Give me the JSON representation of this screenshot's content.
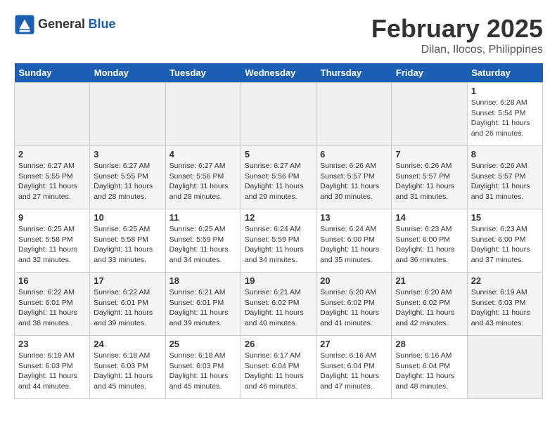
{
  "header": {
    "logo_general": "General",
    "logo_blue": "Blue",
    "title": "February 2025",
    "subtitle": "Dilan, Ilocos, Philippines"
  },
  "weekdays": [
    "Sunday",
    "Monday",
    "Tuesday",
    "Wednesday",
    "Thursday",
    "Friday",
    "Saturday"
  ],
  "weeks": [
    [
      {
        "day": "",
        "info": ""
      },
      {
        "day": "",
        "info": ""
      },
      {
        "day": "",
        "info": ""
      },
      {
        "day": "",
        "info": ""
      },
      {
        "day": "",
        "info": ""
      },
      {
        "day": "",
        "info": ""
      },
      {
        "day": "1",
        "info": "Sunrise: 6:28 AM\nSunset: 5:54 PM\nDaylight: 11 hours and 26 minutes."
      }
    ],
    [
      {
        "day": "2",
        "info": "Sunrise: 6:27 AM\nSunset: 5:55 PM\nDaylight: 11 hours and 27 minutes."
      },
      {
        "day": "3",
        "info": "Sunrise: 6:27 AM\nSunset: 5:55 PM\nDaylight: 11 hours and 28 minutes."
      },
      {
        "day": "4",
        "info": "Sunrise: 6:27 AM\nSunset: 5:56 PM\nDaylight: 11 hours and 28 minutes."
      },
      {
        "day": "5",
        "info": "Sunrise: 6:27 AM\nSunset: 5:56 PM\nDaylight: 11 hours and 29 minutes."
      },
      {
        "day": "6",
        "info": "Sunrise: 6:26 AM\nSunset: 5:57 PM\nDaylight: 11 hours and 30 minutes."
      },
      {
        "day": "7",
        "info": "Sunrise: 6:26 AM\nSunset: 5:57 PM\nDaylight: 11 hours and 31 minutes."
      },
      {
        "day": "8",
        "info": "Sunrise: 6:26 AM\nSunset: 5:57 PM\nDaylight: 11 hours and 31 minutes."
      }
    ],
    [
      {
        "day": "9",
        "info": "Sunrise: 6:25 AM\nSunset: 5:58 PM\nDaylight: 11 hours and 32 minutes."
      },
      {
        "day": "10",
        "info": "Sunrise: 6:25 AM\nSunset: 5:58 PM\nDaylight: 11 hours and 33 minutes."
      },
      {
        "day": "11",
        "info": "Sunrise: 6:25 AM\nSunset: 5:59 PM\nDaylight: 11 hours and 34 minutes."
      },
      {
        "day": "12",
        "info": "Sunrise: 6:24 AM\nSunset: 5:59 PM\nDaylight: 11 hours and 34 minutes."
      },
      {
        "day": "13",
        "info": "Sunrise: 6:24 AM\nSunset: 6:00 PM\nDaylight: 11 hours and 35 minutes."
      },
      {
        "day": "14",
        "info": "Sunrise: 6:23 AM\nSunset: 6:00 PM\nDaylight: 11 hours and 36 minutes."
      },
      {
        "day": "15",
        "info": "Sunrise: 6:23 AM\nSunset: 6:00 PM\nDaylight: 11 hours and 37 minutes."
      }
    ],
    [
      {
        "day": "16",
        "info": "Sunrise: 6:22 AM\nSunset: 6:01 PM\nDaylight: 11 hours and 38 minutes."
      },
      {
        "day": "17",
        "info": "Sunrise: 6:22 AM\nSunset: 6:01 PM\nDaylight: 11 hours and 39 minutes."
      },
      {
        "day": "18",
        "info": "Sunrise: 6:21 AM\nSunset: 6:01 PM\nDaylight: 11 hours and 39 minutes."
      },
      {
        "day": "19",
        "info": "Sunrise: 6:21 AM\nSunset: 6:02 PM\nDaylight: 11 hours and 40 minutes."
      },
      {
        "day": "20",
        "info": "Sunrise: 6:20 AM\nSunset: 6:02 PM\nDaylight: 11 hours and 41 minutes."
      },
      {
        "day": "21",
        "info": "Sunrise: 6:20 AM\nSunset: 6:02 PM\nDaylight: 11 hours and 42 minutes."
      },
      {
        "day": "22",
        "info": "Sunrise: 6:19 AM\nSunset: 6:03 PM\nDaylight: 11 hours and 43 minutes."
      }
    ],
    [
      {
        "day": "23",
        "info": "Sunrise: 6:19 AM\nSunset: 6:03 PM\nDaylight: 11 hours and 44 minutes."
      },
      {
        "day": "24",
        "info": "Sunrise: 6:18 AM\nSunset: 6:03 PM\nDaylight: 11 hours and 45 minutes."
      },
      {
        "day": "25",
        "info": "Sunrise: 6:18 AM\nSunset: 6:03 PM\nDaylight: 11 hours and 45 minutes."
      },
      {
        "day": "26",
        "info": "Sunrise: 6:17 AM\nSunset: 6:04 PM\nDaylight: 11 hours and 46 minutes."
      },
      {
        "day": "27",
        "info": "Sunrise: 6:16 AM\nSunset: 6:04 PM\nDaylight: 11 hours and 47 minutes."
      },
      {
        "day": "28",
        "info": "Sunrise: 6:16 AM\nSunset: 6:04 PM\nDaylight: 11 hours and 48 minutes."
      },
      {
        "day": "",
        "info": ""
      }
    ]
  ]
}
